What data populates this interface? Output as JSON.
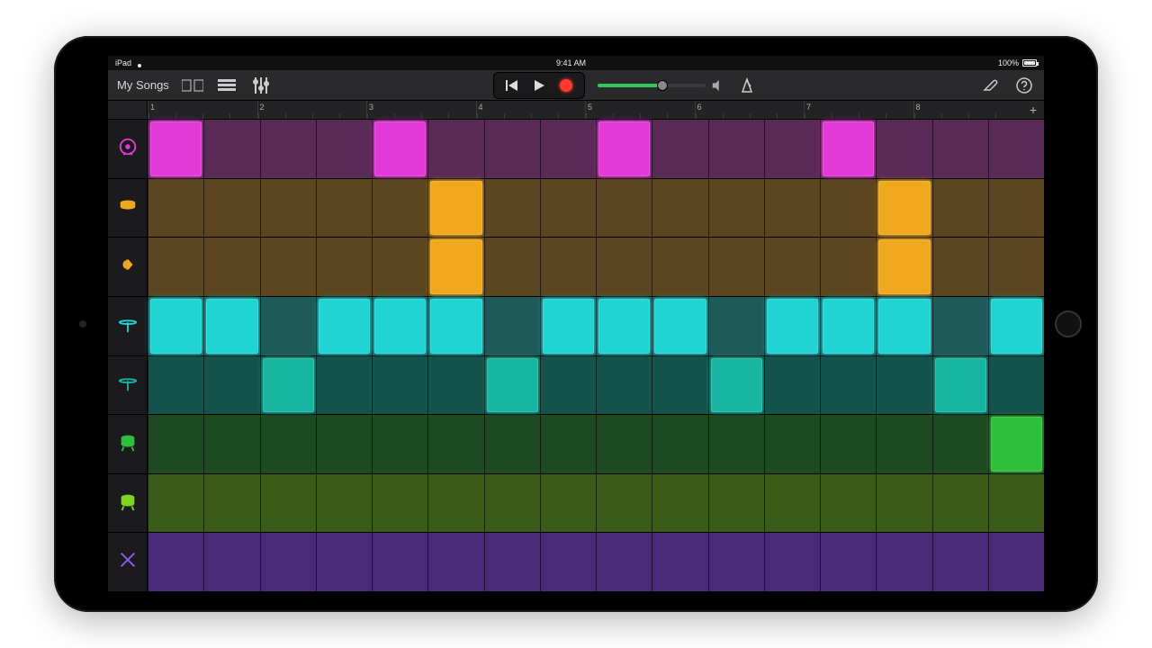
{
  "status": {
    "device": "iPad",
    "time": "9:41 AM",
    "battery": "100%"
  },
  "toolbar": {
    "back_label": "My Songs"
  },
  "ruler": {
    "bars": [
      "1",
      "2",
      "3",
      "4",
      "5",
      "6",
      "7",
      "8"
    ]
  },
  "colors": {
    "magenta_on": "#e339d6",
    "magenta_off": "#5a2a57",
    "amber_on": "#f0a81e",
    "amber_off": "#5a4520",
    "cyan_on": "#22d3d3",
    "cyan_off": "#1e5a5a",
    "teal_on": "#18b6a0",
    "teal_off": "#14534c",
    "green_on": "#2fbf3a",
    "green_off": "#1e4a22",
    "lime_on": "#7ed321",
    "lime_off": "#3a5a1a",
    "violet_off": "#4a2a78"
  },
  "tracks": [
    {
      "name": "kick",
      "icon": "kick",
      "color": "magenta",
      "pattern": [
        1,
        0,
        0,
        0,
        1,
        0,
        0,
        0,
        1,
        0,
        0,
        0,
        1,
        0,
        0,
        0
      ]
    },
    {
      "name": "snare",
      "icon": "snare",
      "color": "amber",
      "pattern": [
        0,
        0,
        0,
        0,
        0,
        1,
        0,
        0,
        0,
        0,
        0,
        0,
        0,
        1,
        0,
        0
      ]
    },
    {
      "name": "clap",
      "icon": "clap",
      "color": "amber",
      "pattern": [
        0,
        0,
        0,
        0,
        0,
        1,
        0,
        0,
        0,
        0,
        0,
        0,
        0,
        1,
        0,
        0
      ]
    },
    {
      "name": "hihat1",
      "icon": "hihat",
      "color": "cyan",
      "pattern": [
        1,
        1,
        0,
        1,
        1,
        1,
        0,
        1,
        1,
        1,
        0,
        1,
        1,
        1,
        0,
        1
      ]
    },
    {
      "name": "hihat2",
      "icon": "hihat",
      "color": "teal",
      "pattern": [
        0,
        0,
        1,
        0,
        0,
        0,
        1,
        0,
        0,
        0,
        1,
        0,
        0,
        0,
        1,
        0
      ]
    },
    {
      "name": "tom1",
      "icon": "tom",
      "color": "green",
      "pattern": [
        0,
        0,
        0,
        0,
        0,
        0,
        0,
        0,
        0,
        0,
        0,
        0,
        0,
        0,
        0,
        1
      ]
    },
    {
      "name": "tom2",
      "icon": "tom",
      "color": "lime",
      "pattern": [
        0,
        0,
        0,
        0,
        0,
        0,
        0,
        0,
        0,
        0,
        0,
        0,
        0,
        0,
        0,
        0
      ]
    },
    {
      "name": "sticks",
      "icon": "sticks",
      "color": "violet",
      "pattern": [
        0,
        0,
        0,
        0,
        0,
        0,
        0,
        0,
        0,
        0,
        0,
        0,
        0,
        0,
        0,
        0
      ]
    }
  ]
}
